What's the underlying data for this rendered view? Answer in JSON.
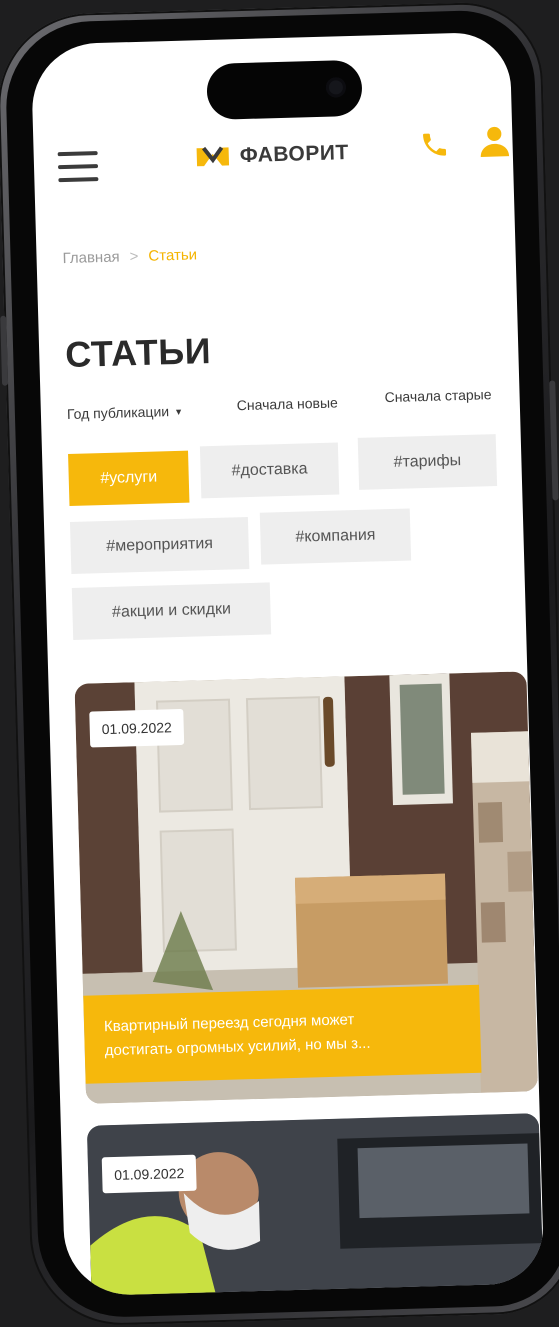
{
  "header": {
    "logo_text": "ФАВОРИТ",
    "menu_icon": "hamburger-menu-icon",
    "phone_icon": "phone-icon",
    "user_icon": "user-icon",
    "brand_color": "#f6b80c"
  },
  "breadcrumb": {
    "home": "Главная",
    "separator": ">",
    "current": "Статьи"
  },
  "page": {
    "title": "СТАТЬИ"
  },
  "sort": {
    "year_label": "Год публикации",
    "newest_label": "Сначала новые",
    "oldest_label": "Сначала старые"
  },
  "tags": [
    {
      "label": "#услуги",
      "active": true
    },
    {
      "label": "#доставка",
      "active": false
    },
    {
      "label": "#тарифы",
      "active": false
    },
    {
      "label": "#мероприятия",
      "active": false
    },
    {
      "label": "#компания",
      "active": false
    },
    {
      "label": "#акции и скидки",
      "active": false
    }
  ],
  "articles": [
    {
      "date": "01.09.2022",
      "excerpt_line1": "Квартирный переезд сегодня может",
      "excerpt_line2": "достигать огромных усилий, но мы з..."
    },
    {
      "date": "01.09.2022"
    }
  ]
}
